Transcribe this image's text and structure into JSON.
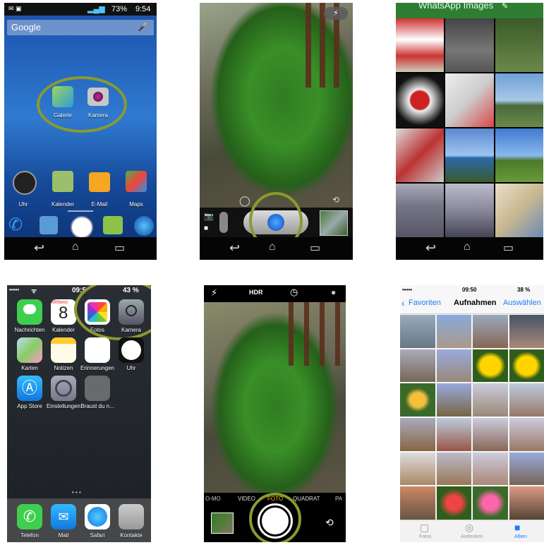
{
  "android_home": {
    "status_time": "9:54",
    "battery": "73%",
    "search_label": "Google",
    "apps_top": [
      {
        "label": "Galerie"
      },
      {
        "label": "Kamera"
      }
    ],
    "dock": [
      {
        "label": "Uhr"
      },
      {
        "label": "Kalender"
      },
      {
        "label": "E-Mail"
      },
      {
        "label": "Maps"
      }
    ]
  },
  "ios_home": {
    "carrier": "•••••",
    "time": "09:5",
    "battery": "43 %",
    "calendar_day": "Mittwoc",
    "calendar_date": "8",
    "row1": [
      {
        "label": "Nachrichten"
      },
      {
        "label": "Kalender"
      },
      {
        "label": "Fotos"
      },
      {
        "label": "Kamera"
      }
    ],
    "row2": [
      {
        "label": "Karten"
      },
      {
        "label": "Notizen"
      },
      {
        "label": "Erinnerungen"
      },
      {
        "label": "Uhr"
      }
    ],
    "row3": [
      {
        "label": "App Store"
      },
      {
        "label": "Einstellungen"
      },
      {
        "label": "Braust du n..."
      }
    ],
    "dock": [
      {
        "label": "Telefon"
      },
      {
        "label": "Mail"
      },
      {
        "label": "Safari"
      },
      {
        "label": "Kontakte"
      }
    ]
  },
  "ios_camera": {
    "hdr_label": "HDR",
    "modes": [
      {
        "label": "O-MO"
      },
      {
        "label": "VIDEO"
      },
      {
        "label": "FOTO"
      },
      {
        "label": "QUADRAT"
      },
      {
        "label": "PA"
      }
    ]
  },
  "android_gallery": {
    "title": "WhatsApp Images"
  },
  "ios_photos": {
    "carrier": "•••••",
    "time": "09:50",
    "battery": "38 %",
    "back_label": "Favoriten",
    "title": "Aufnahmen",
    "select_label": "Auswählen",
    "tabs": [
      {
        "label": "Fotos"
      },
      {
        "label": "Andenken"
      },
      {
        "label": "Alben"
      }
    ]
  },
  "colors": {
    "highlight_ring": "#8a9a2e",
    "ios_blue": "#1f7cf5"
  }
}
